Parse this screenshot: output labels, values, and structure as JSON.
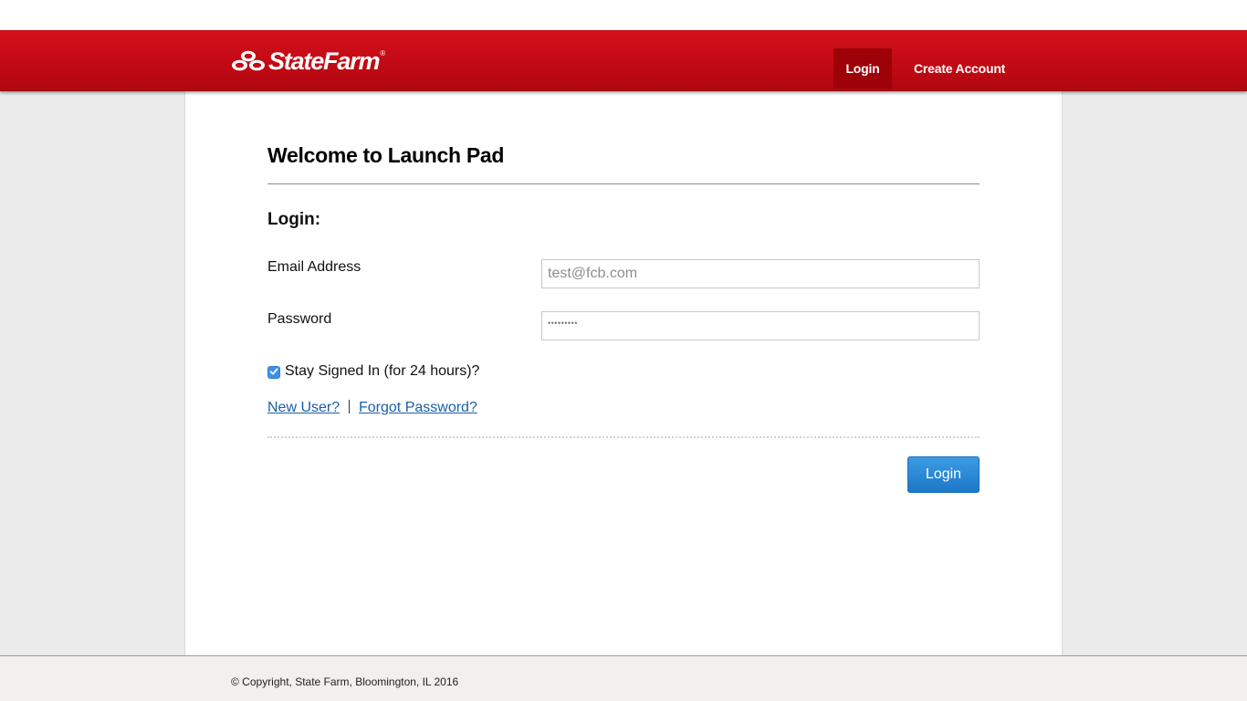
{
  "header": {
    "brand": "StateFarm",
    "brand_mark": "®",
    "nav": {
      "login_label": "Login",
      "create_account_label": "Create Account"
    }
  },
  "main": {
    "welcome_title": "Welcome to Launch Pad",
    "login_heading": "Login:",
    "email": {
      "label": "Email Address",
      "placeholder": "test@fcb.com",
      "value": ""
    },
    "password": {
      "label": "Password",
      "masked_value": "•••••••••"
    },
    "stay_signed_in": {
      "label": "Stay Signed In (for 24 hours)?",
      "checked": true
    },
    "links": {
      "new_user": "New User?",
      "forgot_password": "Forgot Password?"
    },
    "submit_label": "Login"
  },
  "footer": {
    "copyright": "© Copyright, State Farm, Bloomington, IL 2016"
  },
  "colors": {
    "brand_red": "#c20a14",
    "active_nav": "#9c0208",
    "link_blue": "#1a5fa8",
    "button_blue": "#1d78c8"
  }
}
